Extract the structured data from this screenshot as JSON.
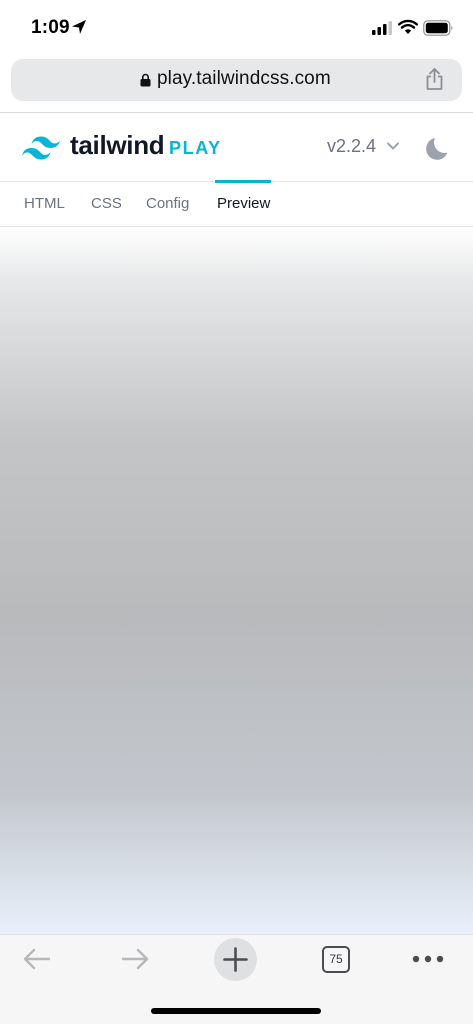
{
  "status_bar": {
    "time": "1:09",
    "icons": [
      "location-arrow-icon",
      "cellular-signal-icon",
      "wifi-icon",
      "battery-icon"
    ]
  },
  "browser": {
    "url": "play.tailwindcss.com",
    "icons": [
      "lock-icon",
      "share-icon"
    ]
  },
  "app": {
    "brand": "tailwind",
    "brand_suffix": "PLAY",
    "brand_color": "#06b6d4",
    "version": "v2.2.4",
    "icons": [
      "tailwind-logo-icon",
      "chevron-down-icon",
      "moon-icon"
    ]
  },
  "tabs": [
    {
      "label": "HTML",
      "active": false
    },
    {
      "label": "CSS",
      "active": false
    },
    {
      "label": "Config",
      "active": false
    },
    {
      "label": "Preview",
      "active": true
    }
  ],
  "toolbar": {
    "tab_count": "75",
    "icons": [
      "back-arrow-icon",
      "forward-arrow-icon",
      "plus-icon",
      "tabs-icon",
      "more-icon"
    ]
  }
}
